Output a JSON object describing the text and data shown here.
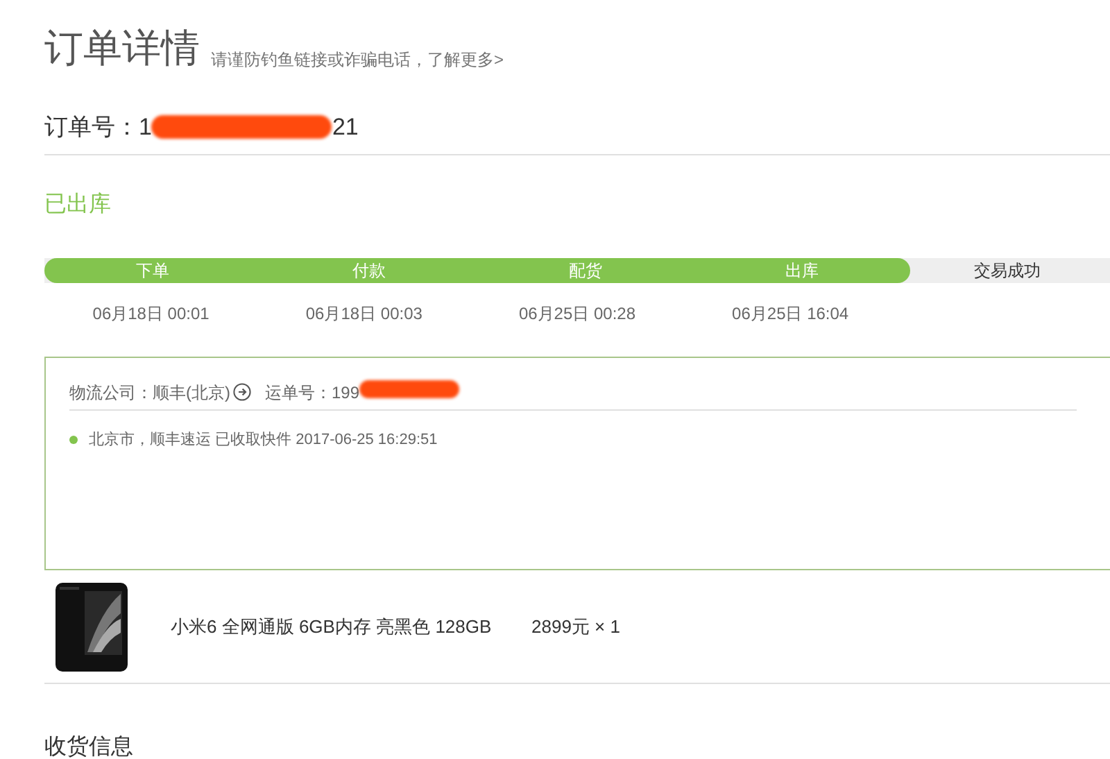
{
  "title": "订单详情",
  "notice_link": "请谨防钓鱼链接或诈骗电话，了解更多>",
  "order": {
    "label": "订单号：",
    "number_start": "1",
    "number_end": "21",
    "redacted": true
  },
  "status": "已出库",
  "steps": [
    {
      "label": "下单",
      "time": "06月18日 00:01",
      "done": true
    },
    {
      "label": "付款",
      "time": "06月18日 00:03",
      "done": true
    },
    {
      "label": "配货",
      "time": "06月25日 00:28",
      "done": true
    },
    {
      "label": "出库",
      "time": "06月25日 16:04",
      "done": true
    },
    {
      "label": "交易成功",
      "done": false
    }
  ],
  "logistics": {
    "company": "物流公司：顺丰(北京)",
    "waybill_label": "运单号：",
    "waybill_start": "199",
    "redacted": true,
    "events": [
      {
        "text": "北京市，顺丰速运 已收取快件 2017-06-25 16:29:51"
      }
    ]
  },
  "products": [
    {
      "name": "小米6 全网通版 6GB内存 亮黑色 128GB",
      "price": "2899元 × 1"
    }
  ],
  "shipping_heading": "收货信息"
}
